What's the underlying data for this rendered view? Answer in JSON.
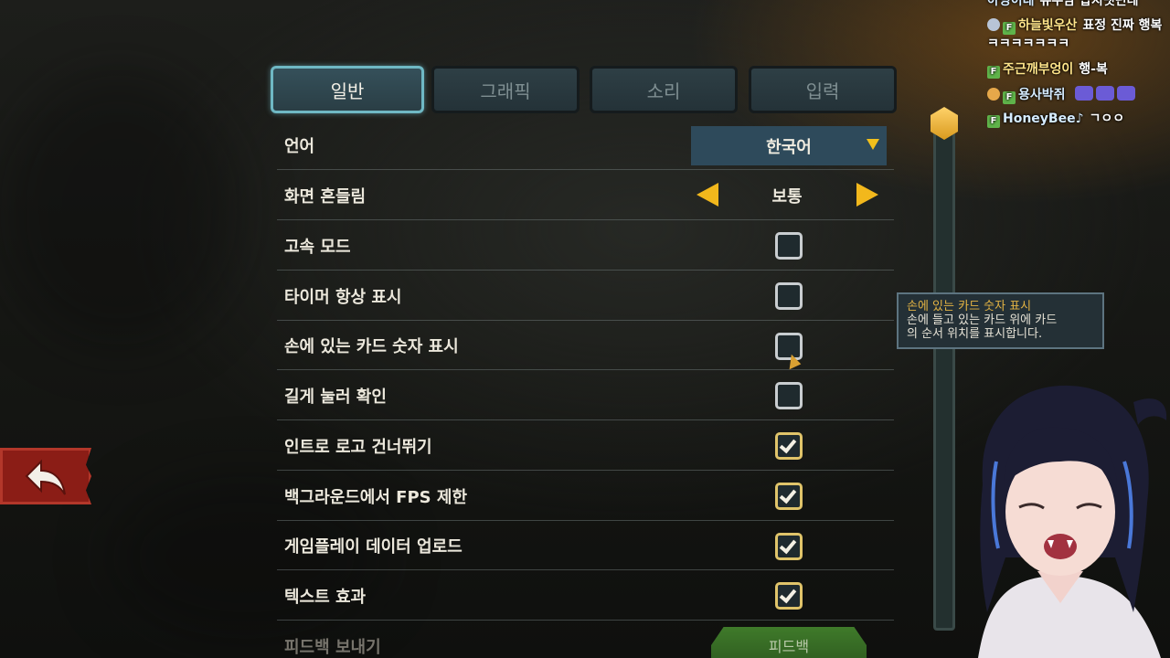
{
  "tabs": [
    {
      "label": "일반",
      "active": true
    },
    {
      "label": "그래픽",
      "active": false
    },
    {
      "label": "소리",
      "active": false
    },
    {
      "label": "입력",
      "active": false
    }
  ],
  "settings": {
    "language": {
      "label": "언어",
      "value": "한국어"
    },
    "screen_shake": {
      "label": "화면 흔들림",
      "value": "보통"
    },
    "checkbox_rows": [
      {
        "label": "고속 모드",
        "checked": false
      },
      {
        "label": "타이머 항상 표시",
        "checked": false
      },
      {
        "label": "손에 있는 카드 숫자 표시",
        "checked": false
      },
      {
        "label": "길게 눌러 확인",
        "checked": false
      },
      {
        "label": "인트로 로고 건너뛰기",
        "checked": true
      },
      {
        "label": "백그라운드에서 FPS 제한",
        "checked": true
      },
      {
        "label": "게임플레이 데이터 업로드",
        "checked": true
      },
      {
        "label": "텍스트 효과",
        "checked": true
      }
    ],
    "feedback": {
      "label": "피드백 보내기",
      "button": "피드백"
    }
  },
  "tooltip": {
    "title": "손에 있는 카드 숫자 표시",
    "line1": "손에 들고 있는 카드 위에 카드",
    "line2": "의 순서 위치를 표시합니다."
  },
  "chat": [
    {
      "user": "아잉이네",
      "message": "유무남 답지뱃던데"
    },
    {
      "user": "하늘빛우산",
      "message": "표정 진짜 행복"
    },
    {
      "user": "",
      "message": "ㅋㅋㅋㅋㅋㅋㅋ"
    },
    {
      "user": "주근깨부엉이",
      "message": "행-복"
    },
    {
      "user": "용사박쥐",
      "message": ""
    },
    {
      "user": "HoneyBee♪",
      "message": "ㄱㅇㅇ"
    }
  ],
  "colors": {
    "accent_gold": "#f2b81c",
    "tab_active_border": "#6fb8c4",
    "back_button": "#8b1d16",
    "feedback_button": "#3f7a2a",
    "tooltip_title": "#e3b343"
  },
  "icons": {
    "back": "back-arrow-icon",
    "dropdown": "caret-down-icon",
    "selector_left": "caret-left-icon",
    "selector_right": "caret-right-icon",
    "scroll": "scroll-thumb-gem"
  }
}
